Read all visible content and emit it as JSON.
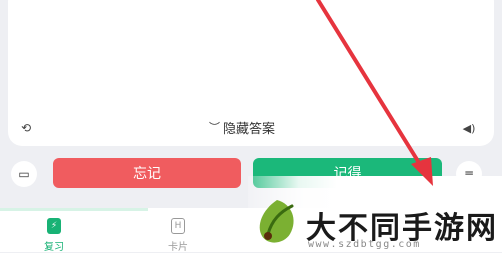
{
  "toolbar": {
    "hide_answer_label": "隐藏答案"
  },
  "actions": {
    "forget_label": "忘记",
    "remember_label": "记得"
  },
  "tabs": [
    {
      "label": "复习",
      "icon_char": "⚡",
      "active": true
    },
    {
      "label": "卡片",
      "icon_char": "H",
      "active": false
    }
  ],
  "watermark": {
    "title": "大不同手游网",
    "url": "www.szdbtgg.com"
  },
  "colors": {
    "forget": "#f05c5f",
    "remember": "#1bb87a",
    "accent": "#18b275",
    "annotation_arrow": "#e6343e"
  }
}
